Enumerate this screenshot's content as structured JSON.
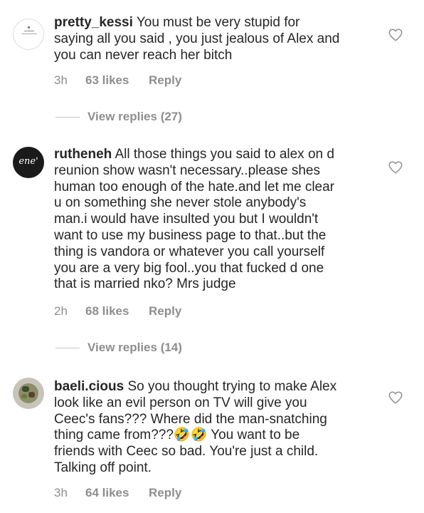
{
  "comments": [
    {
      "username": "pretty_kessi",
      "lines": [
        " You must be very stupid for",
        "saying all you said , you just jealous of Alex and",
        "you can never reach her bitch"
      ],
      "time": "3h",
      "likes": "63 likes",
      "reply": "Reply",
      "view_replies": "View replies (27)"
    },
    {
      "username": "rutheneh",
      "avatar_text": "ene'",
      "lines": [
        " All those things you said to alex on d",
        "reunion show wasn't necessary..please shes",
        "human too enough of the hate.and let me clear",
        "u on something she never stole anybody's",
        "man.i would have insulted you but I wouldn't",
        "want to use my business page to that..but the",
        "thing is vandora or whatever you call yourself",
        "you are a very big fool..you that fucked d one",
        "that is married nko? Mrs judge"
      ],
      "time": "2h",
      "likes": "68 likes",
      "reply": "Reply",
      "view_replies": "View replies (14)"
    },
    {
      "username": "baeli.cious",
      "lines": [
        " So you thought trying to make Alex",
        "look like an evil person on TV will give you",
        "Ceec's fans??? Where did the man-snatching",
        "thing came from???🤣🤣 You want to be",
        "friends with Ceec so bad. You're just a child.",
        "Talking off point."
      ],
      "time": "3h",
      "likes": "64 likes",
      "reply": "Reply"
    }
  ],
  "icons": {
    "like": "heart-outline-icon"
  },
  "colors": {
    "text": "#262626",
    "secondary": "#8e8e8e"
  }
}
